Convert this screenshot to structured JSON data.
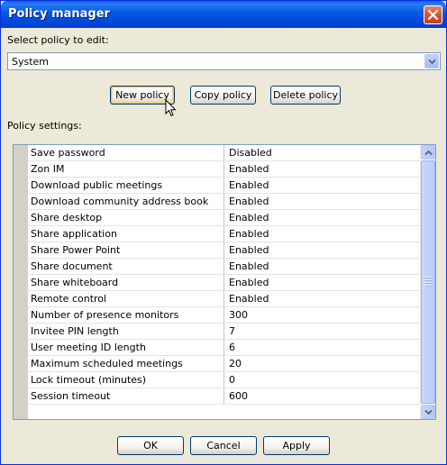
{
  "window": {
    "title": "Policy manager"
  },
  "select_label": "Select policy to edit:",
  "policy_select": {
    "value": "System"
  },
  "buttons": {
    "new_policy": "New policy",
    "copy_policy": "Copy policy",
    "delete_policy": "Delete policy"
  },
  "settings_label": "Policy settings:",
  "settings": [
    {
      "name": "Save password",
      "value": "Disabled"
    },
    {
      "name": "Zon IM",
      "value": "Enabled"
    },
    {
      "name": "Download public meetings",
      "value": "Enabled"
    },
    {
      "name": "Download community address book",
      "value": "Enabled"
    },
    {
      "name": "Share desktop",
      "value": "Enabled"
    },
    {
      "name": "Share application",
      "value": "Enabled"
    },
    {
      "name": "Share Power Point",
      "value": "Enabled"
    },
    {
      "name": "Share document",
      "value": "Enabled"
    },
    {
      "name": "Share whiteboard",
      "value": "Enabled"
    },
    {
      "name": "Remote control",
      "value": "Enabled"
    },
    {
      "name": "Number of presence monitors",
      "value": "300"
    },
    {
      "name": "Invitee PIN length",
      "value": "7"
    },
    {
      "name": "User meeting ID length",
      "value": "6"
    },
    {
      "name": "Maximum scheduled meetings",
      "value": "20"
    },
    {
      "name": "Lock timeout (minutes)",
      "value": "0"
    },
    {
      "name": "Session timeout",
      "value": "600"
    }
  ],
  "footer": {
    "ok": "OK",
    "cancel": "Cancel",
    "apply": "Apply"
  },
  "colors": {
    "titlebar": "#0058e6",
    "window_bg": "#ece9d8",
    "close": "#d9542b"
  }
}
